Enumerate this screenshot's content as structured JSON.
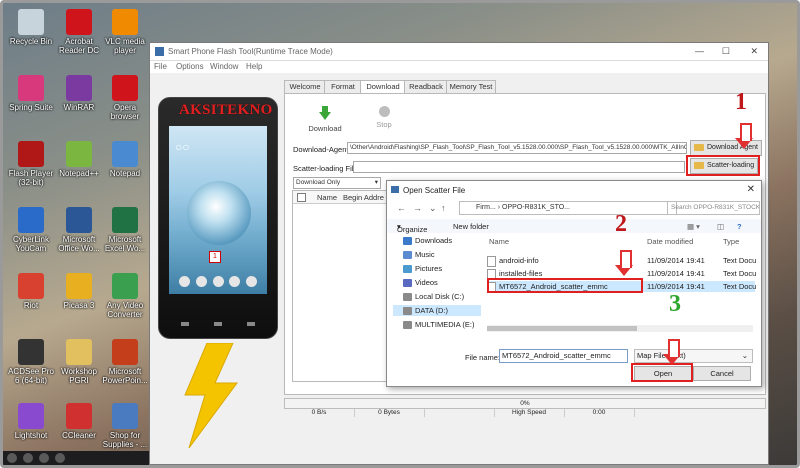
{
  "desktop": {
    "icons": [
      {
        "label": "Recycle Bin",
        "color": "#c8d4dc"
      },
      {
        "label": "Acrobat Reader DC",
        "color": "#d0141c"
      },
      {
        "label": "VLC media player",
        "color": "#f08a00"
      },
      {
        "label": "Spring Suite",
        "color": "#d8387c"
      },
      {
        "label": "WinRAR",
        "color": "#7a3aa0"
      },
      {
        "label": "Opera browser",
        "color": "#d0141c"
      },
      {
        "label": "Flash Player (32-bit)",
        "color": "#b01818"
      },
      {
        "label": "Notepad++",
        "color": "#7ab640"
      },
      {
        "label": "Notepad",
        "color": "#4a8ad0"
      },
      {
        "label": "CyberLink YouCam",
        "color": "#2a6ac8"
      },
      {
        "label": "Microsoft Office Wo...",
        "color": "#2b5797"
      },
      {
        "label": "Microsoft Excel Wo...",
        "color": "#207245"
      },
      {
        "label": "Riot",
        "color": "#d84030"
      },
      {
        "label": "Picasa 3",
        "color": "#e8b020"
      },
      {
        "label": "Any Video Converter",
        "color": "#3aa050"
      },
      {
        "label": "ACDSee Pro 6 (64-bit)",
        "color": "#333333"
      },
      {
        "label": "Workshop PGRI",
        "color": "#e2c060"
      },
      {
        "label": "Microsoft PowerPoin...",
        "color": "#c43e1c"
      },
      {
        "label": "Lightshot",
        "color": "#8a4ad0"
      },
      {
        "label": "CCleaner",
        "color": "#d03030"
      },
      {
        "label": "Shop for Supplies - ...",
        "color": "#4a7ac0"
      }
    ]
  },
  "window": {
    "title": "Smart Phone Flash Tool(Runtime Trace Mode)",
    "menu": [
      "File",
      "Options",
      "Window",
      "Help"
    ],
    "phone_brand": "AKSITEKNO",
    "tabs": [
      "Welcome",
      "Format",
      "Download",
      "Readback",
      "Memory Test"
    ],
    "toolbar": {
      "download": "Download",
      "stop": "Stop"
    },
    "download_agent_label": "Download-Agent",
    "download_agent_value": "\\Other\\Android\\Flashing\\SP_Flash_Tool\\SP_Flash_Tool_v5.1528.00.000\\SP_Flash_Tool_v5.1528.00.000\\MTK_AllInOne_DA.bin",
    "download_agent_button": "Download Agent",
    "scatter_label": "Scatter-loading File",
    "scatter_button": "Scatter-loading",
    "mode_select": "Download Only",
    "grid_headers": [
      "Name",
      "Begin Addre"
    ],
    "progress": "0%",
    "status_cells": [
      "0 B/s",
      "0 Bytes",
      "",
      "High Speed",
      "0:00",
      ""
    ]
  },
  "dialog": {
    "title": "Open Scatter File",
    "path": "Firm... › OPPO-R831K_STO...",
    "search_placeholder": "Search OPPO-R831K_STOCK-...",
    "organize": "Organize",
    "new_folder": "New folder",
    "nav_items": [
      "Downloads",
      "Music",
      "Pictures",
      "Videos",
      "Local Disk (C:)",
      "DATA (D:)",
      "MULTIMEDIA (E:)"
    ],
    "nav_colors": [
      "#3a7ac8",
      "#5a8ad0",
      "#4a9ad0",
      "#5a6ac0",
      "#8a8a8a",
      "#8a8a8a",
      "#8a8a8a"
    ],
    "columns": [
      "Name",
      "Date modified",
      "Type"
    ],
    "files": [
      {
        "name": "android-info",
        "date": "11/09/2014 19:41",
        "type": "Text Docu"
      },
      {
        "name": "installed-files",
        "date": "11/09/2014 19:41",
        "type": "Text Docu"
      },
      {
        "name": "MT6572_Android_scatter_emmc",
        "date": "11/09/2014 19:41",
        "type": "Text Docu"
      }
    ],
    "file_name_label": "File name:",
    "file_name_value": "MT6572_Android_scatter_emmc",
    "filter": "Map File (*.txt)",
    "open": "Open",
    "cancel": "Cancel"
  },
  "annotations": [
    "1",
    "2",
    "3"
  ],
  "colors": {
    "annotation_red": "#c0171b",
    "annotation_green": "#2ca52c",
    "highlight_box": "#e02020",
    "lightning": "#f5c400"
  }
}
